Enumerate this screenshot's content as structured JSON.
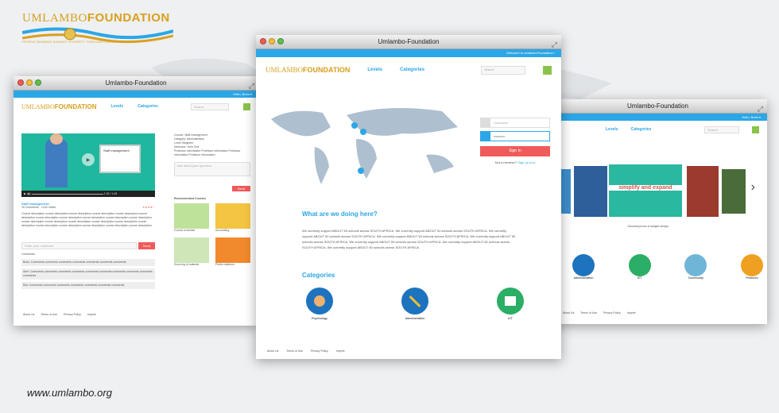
{
  "brand": {
    "name_a": "UMLAMBO",
    "name_b": "FOUNDATION",
    "tagline": "PEOPLE WINNING AGAINST POVERTY THROUGH EDUCATION"
  },
  "footer_url": "www.umlambo.org",
  "left": {
    "title": "Umlambo-Foundation",
    "hello": "Hello, Boris ▾",
    "nav": [
      "Levels",
      "Categories"
    ],
    "search": "Search",
    "slide": "Staff management",
    "time": "1:25 / 1:45",
    "course_title": "Staff management",
    "comments": "15 Comments",
    "views": "1234 Views",
    "description": "Course description course description course description course description course description course description course description course description course description course description course description course description course description course description course description course description course description course description course description course description course description course description",
    "comment_placeholder": "Enter your comment",
    "send": "Send",
    "comments_label": "Comments",
    "info": {
      "course": "Course: Staff management",
      "category": "Category: Administration",
      "level": "Level: Beginner",
      "instructor": "Instructor: John Doe",
      "bio": "Professor information Professor information Professor information Professor information"
    },
    "question_placeholder": "Ask about your question",
    "recommended": "Recommended Courses",
    "courses": [
      "Course schedule",
      "Accounting",
      "Sourcing of material",
      "Public relations"
    ],
    "comment_rows": [
      "Boris: Comments comments comments comments comments comments comments",
      "Ariel: Comments comments comments comments comments comments comments comments comments comments",
      "Elia: Comments comments comments comments comments comments comments"
    ],
    "footer": [
      "About Us",
      "Terms of Use",
      "Privacy Policy",
      "Imprint"
    ]
  },
  "center": {
    "title": "Umlambo-Foundation",
    "welcome": "Welcome to umlamboFoundation !",
    "nav": [
      "Levels",
      "Categories"
    ],
    "search": "Search",
    "username": "Username",
    "password": "••••••••••",
    "signin": "Sign In",
    "member": "Not a member?",
    "signup": "Sign up now",
    "heading": "What are we doing here?",
    "paragraph": "We currently support ABOUT 50 schools across SOUTH AFRICA. We currently support ABOUT 50 schools across SOUTH AFRICA. We currently support ABOUT 50 schools across SOUTH AFRICA. We currently support ABOUT 50 schools across SOUTH AFRICA. We currently support ABOUT 50 schools across SOUTH AFRICA. We currently support ABOUT 50 schools across SOUTH AFRICA. We currently support ABOUT 50 schools across SOUTH AFRICA. We currently support ABOUT 50 schools across SOUTH AFRICA.",
    "categories_heading": "Categories",
    "categories": [
      "Psychology",
      "Administration",
      "ICT"
    ],
    "footer": [
      "About Us",
      "Terms of Use",
      "Privacy Policy",
      "Imprint"
    ]
  },
  "right": {
    "title": "Umlambo-Foundation",
    "hello": "Hello, Boris ▾",
    "nav": [
      "Levels",
      "Categories"
    ],
    "search": "Search",
    "slide_caption": "Geometry,icons & badges design",
    "slide_text": "simplify and expand",
    "categories": [
      "Administration",
      "ICT",
      "Community",
      "Finances"
    ],
    "footer": [
      "About Us",
      "Terms of Use",
      "Privacy Policy",
      "Imprint"
    ]
  },
  "colors": {
    "accent": "#2ba6e6",
    "signin": "#f05a5a",
    "search_btn": "#8bc34a",
    "gold": "#d8a01c"
  }
}
